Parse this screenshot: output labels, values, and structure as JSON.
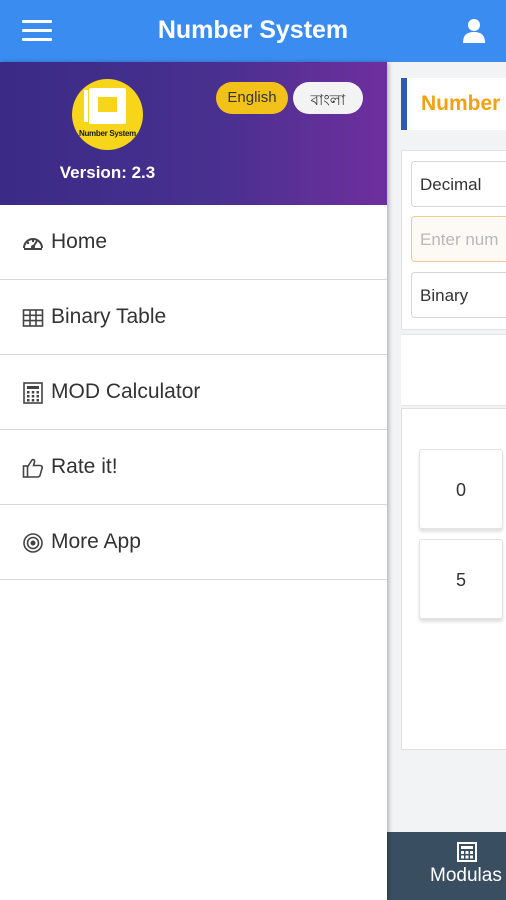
{
  "app": {
    "title": "Number System",
    "primary_color": "#3b8cf0",
    "accent_color": "#f4a011"
  },
  "topbar": {
    "menu_icon": "hamburger-icon",
    "user_icon": "user-icon"
  },
  "drawer": {
    "logo_text": "Number System",
    "version": "Version: 2.3",
    "languages": [
      {
        "label": "English",
        "selected": true
      },
      {
        "label": "বাংলা",
        "selected": false
      }
    ],
    "items": [
      {
        "label": "Home",
        "icon": "dashboard-icon"
      },
      {
        "label": "Binary Table",
        "icon": "table-icon"
      },
      {
        "label": "MOD Calculator",
        "icon": "calculator-icon"
      },
      {
        "label": "Rate it!",
        "icon": "thumbs-up-icon"
      },
      {
        "label": "More App",
        "icon": "target-icon"
      }
    ]
  },
  "main": {
    "section_title": "Number",
    "from_select": "Decimal",
    "input_placeholder": "Enter num",
    "to_select": "Binary",
    "keys": [
      "0",
      "5"
    ],
    "bottom_nav": {
      "label": "Modulas",
      "icon": "calculator-icon"
    }
  }
}
